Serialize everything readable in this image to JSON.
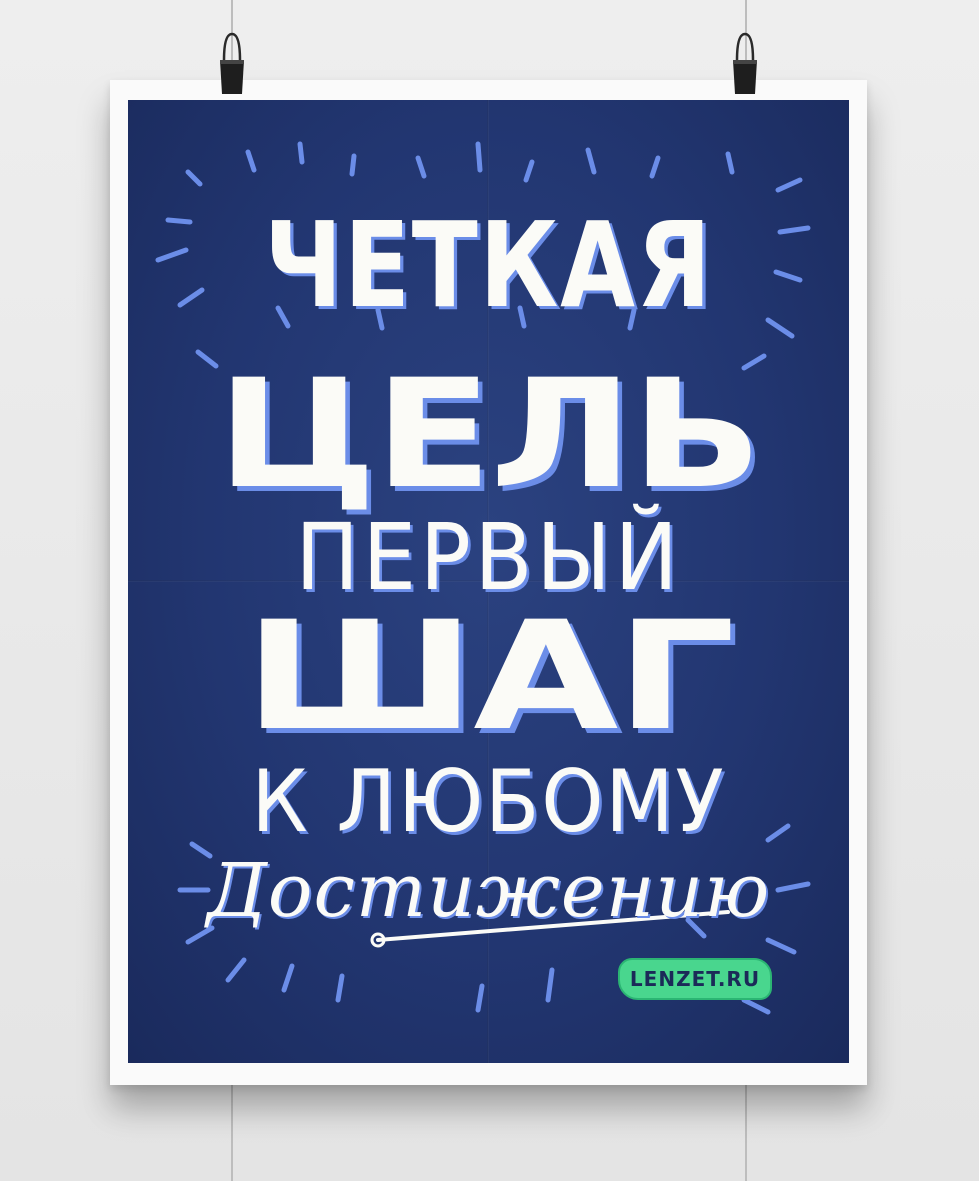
{
  "poster": {
    "lines": [
      "ЧЕТКАЯ",
      "ЦЕЛЬ",
      "ПЕРВЫЙ",
      "ШАГ",
      "К ЛЮБОМУ",
      "Достижению"
    ],
    "brand": "LENZET.RU"
  },
  "colors": {
    "panel_blue": "#223671",
    "accent_blue": "#6b8de8",
    "text_white": "#fbfbf7",
    "badge_green": "#49d68e",
    "paper": "#fafafa",
    "wall": "#e8e8e8"
  },
  "icons": [
    "binder-clip-icon",
    "binder-clip-icon"
  ]
}
